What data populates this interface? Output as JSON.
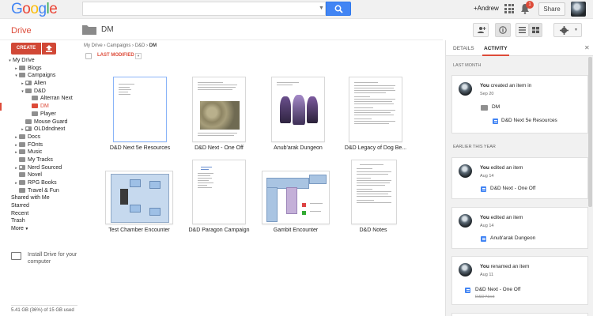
{
  "header": {
    "logo": "Google",
    "search_placeholder": "",
    "user_name": "+Andrew",
    "notification_count": "1",
    "share_label": "Share"
  },
  "toolbar": {
    "app_label": "Drive",
    "folder_title": "DM"
  },
  "sidebar": {
    "create_label": "CREATE",
    "items": [
      {
        "label": "My Drive",
        "depth": 0,
        "arrow": "▾",
        "folder": false
      },
      {
        "label": "Blogs",
        "depth": 1,
        "arrow": "▸",
        "folder": true
      },
      {
        "label": "Campaigns",
        "depth": 1,
        "arrow": "▾",
        "folder": true
      },
      {
        "label": "Alien",
        "depth": 2,
        "arrow": "▸",
        "folder": true,
        "shared": true
      },
      {
        "label": "D&D",
        "depth": 2,
        "arrow": "▾",
        "folder": true
      },
      {
        "label": "Alterran Next",
        "depth": 3,
        "arrow": "",
        "folder": true
      },
      {
        "label": "DM",
        "depth": 3,
        "arrow": "",
        "folder": true,
        "selected": true
      },
      {
        "label": "Player",
        "depth": 3,
        "arrow": "",
        "folder": true
      },
      {
        "label": "Mouse Guard",
        "depth": 2,
        "arrow": "",
        "folder": true
      },
      {
        "label": "OLDdndnext",
        "depth": 2,
        "arrow": "▸",
        "folder": true,
        "shared": true
      },
      {
        "label": "Docs",
        "depth": 1,
        "arrow": "▸",
        "folder": true
      },
      {
        "label": "FOnts",
        "depth": 1,
        "arrow": "▸",
        "folder": true
      },
      {
        "label": "Music",
        "depth": 1,
        "arrow": "▸",
        "folder": true
      },
      {
        "label": "My Tracks",
        "depth": 1,
        "arrow": "",
        "folder": true
      },
      {
        "label": "Nerd Sourced",
        "depth": 1,
        "arrow": "▸",
        "folder": true,
        "shared": true
      },
      {
        "label": "Novel",
        "depth": 1,
        "arrow": "",
        "folder": true
      },
      {
        "label": "RPG Books",
        "depth": 1,
        "arrow": "▸",
        "folder": true
      },
      {
        "label": "Travel & Fun",
        "depth": 1,
        "arrow": "",
        "folder": true
      },
      {
        "label": "Shared with Me",
        "depth": 0,
        "arrow": "",
        "folder": false
      },
      {
        "label": "Starred",
        "depth": 0,
        "arrow": "",
        "folder": false
      },
      {
        "label": "Recent",
        "depth": 0,
        "arrow": "",
        "folder": false
      },
      {
        "label": "Trash",
        "depth": 0,
        "arrow": "",
        "folder": false
      },
      {
        "label": "More",
        "depth": 0,
        "arrow": "",
        "folder": false,
        "more": true
      }
    ],
    "install_text": "Install Drive for your computer",
    "storage_text": "5.41 GB (36%) of 15 GB used"
  },
  "main": {
    "breadcrumb": [
      "My Drive",
      "Campaigns",
      "D&D",
      "DM"
    ],
    "sort_label": "LAST MODIFIED",
    "files": [
      "D&D Next 5e Resources",
      "D&D Next - One Off",
      "Anub'arak Dungeon",
      "D&D Legacy of Dog Be...",
      "Test Chamber Encounter",
      "D&D Paragon Campaign",
      "Gambit Encounter",
      "D&D Notes"
    ]
  },
  "panel": {
    "tabs": [
      "DETAILS",
      "ACTIVITY"
    ],
    "sections": [
      "LAST MONTH",
      "EARLIER THIS YEAR"
    ],
    "activities": [
      {
        "who": "You",
        "action": " created an item in",
        "date": "Sep 20",
        "folder": "DM",
        "item": "D&D Next 5e Resources"
      },
      {
        "who": "You",
        "action": " edited an item",
        "date": "Aug 14",
        "item": "D&D Next - One Off"
      },
      {
        "who": "You",
        "action": " edited an item",
        "date": "Aug 14",
        "item": "Anub'arak Dungeon"
      },
      {
        "who": "You",
        "action": " renamed an item",
        "date": "Aug 11",
        "item": "D&D Next - One Off",
        "old_name": "D&D Next"
      }
    ]
  }
}
